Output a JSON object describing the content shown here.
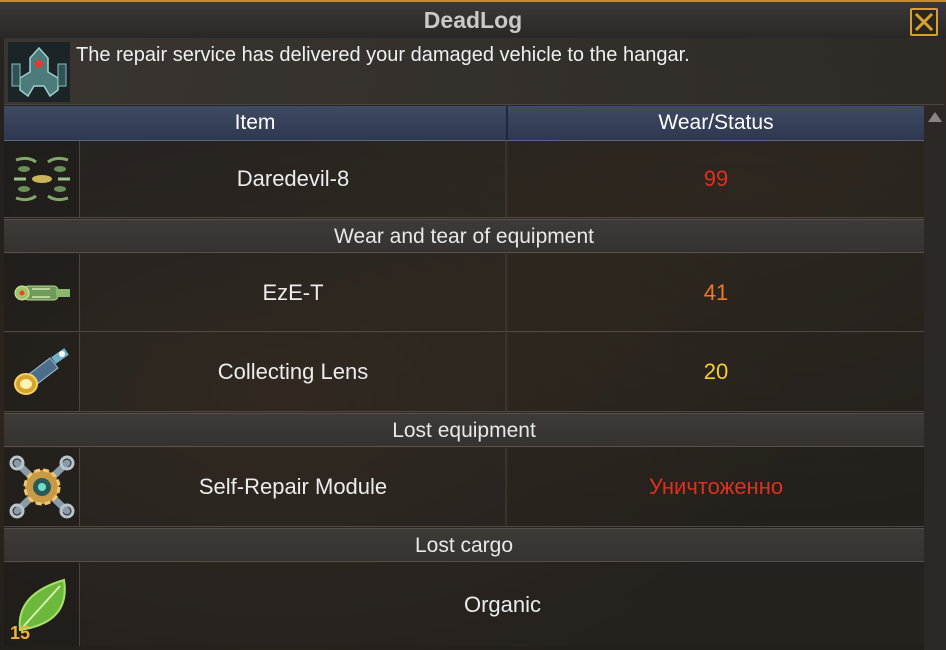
{
  "window": {
    "title": "DeadLog",
    "close_icon": "close-x-icon"
  },
  "message": {
    "text": "The repair service has delivered your damaged vehicle to the hangar.",
    "icon": "robot-vehicle-icon"
  },
  "table": {
    "col_item": "Item",
    "col_status": "Wear/Status"
  },
  "vehicle": {
    "name": "Daredevil-8",
    "value": "99",
    "value_color": "#e0301e",
    "icon": "drone-squadron-icon"
  },
  "sections": {
    "wear": "Wear and tear of equipment",
    "lost_equipment": "Lost equipment",
    "lost_cargo": "Lost cargo"
  },
  "wear_items": [
    {
      "name": "EzE-T",
      "value": "41",
      "value_color": "#f07a2a",
      "icon": "blaster-gun-icon"
    },
    {
      "name": "Collecting Lens",
      "value": "20",
      "value_color": "#f5d02a",
      "icon": "lens-cannon-icon"
    }
  ],
  "lost_items": [
    {
      "name": "Self-Repair Module",
      "value": "Уничтоженно",
      "value_color": "#e0301e",
      "icon": "wrench-gear-module-icon"
    }
  ],
  "cargo": [
    {
      "name": "Organic",
      "quantity": "15",
      "icon": "leaf-icon"
    }
  ]
}
